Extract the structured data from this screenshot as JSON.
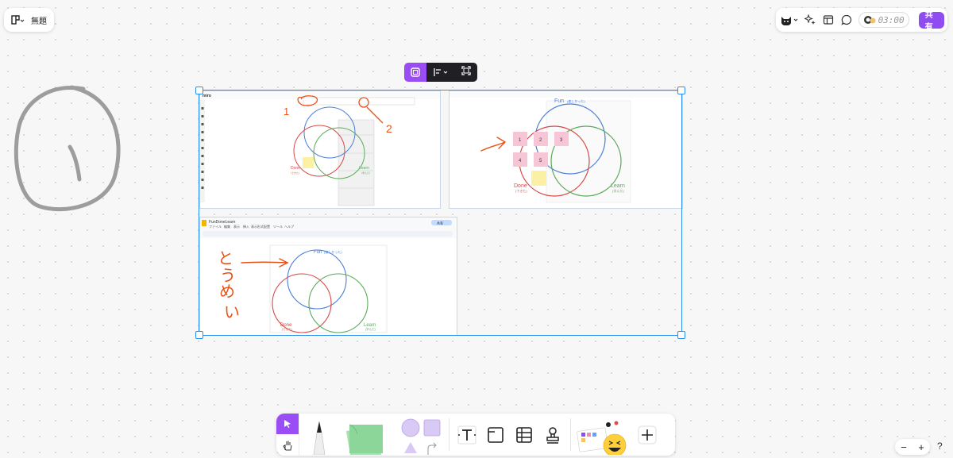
{
  "app": {
    "board_title": "無題"
  },
  "header_right": {
    "timer": "03:00",
    "share_label": "共有"
  },
  "handwriting": {
    "digit": "1"
  },
  "screenshots": {
    "miro": {
      "logo": "miro",
      "markers": [
        "1",
        "2"
      ],
      "labels": {
        "fun": "Fun",
        "done": "Done",
        "done_sub": "(できた)",
        "learn": "Learn",
        "learn_sub": "(学んだ)"
      }
    },
    "fdl_stickies": {
      "title_fun": "Fun",
      "title_fun_sub": "(楽しかった)",
      "stickies": [
        "1",
        "2",
        "3",
        "4",
        "5"
      ],
      "done": "Done",
      "done_sub": "(できた)",
      "learn": "Learn",
      "learn_sub": "(学んだ)"
    },
    "slides": {
      "doc_title": "FunDoneLearn",
      "menu": [
        "ファイル",
        "編集",
        "表示",
        "挿入",
        "表示形式",
        "配置",
        "ツール",
        "ヘルプ"
      ],
      "share_label": "共有",
      "title_fun": "Fun",
      "title_fun_sub": "(楽しかった)",
      "done": "Done",
      "done_sub": "(できた)",
      "learn": "Learn",
      "learn_sub": "(学んだ)",
      "handwritten": [
        "と",
        "う",
        "め",
        "い"
      ]
    }
  },
  "colors": {
    "accent": "#8f4cf0",
    "selection": "#2b8ff1",
    "fun": "#4a7fd4",
    "done": "#d94848",
    "learn": "#5aaa5a",
    "ink": "#e8531a",
    "sticky_pink": "#f7c6d6",
    "sticky_yellow": "#fbf0a4"
  },
  "toolbar": {
    "tools": [
      "select",
      "hand",
      "pen",
      "sticky-note",
      "shapes",
      "text",
      "frame",
      "table",
      "stamp",
      "templates",
      "add"
    ]
  },
  "zoom": {
    "out": "−",
    "in": "+",
    "help": "?"
  }
}
